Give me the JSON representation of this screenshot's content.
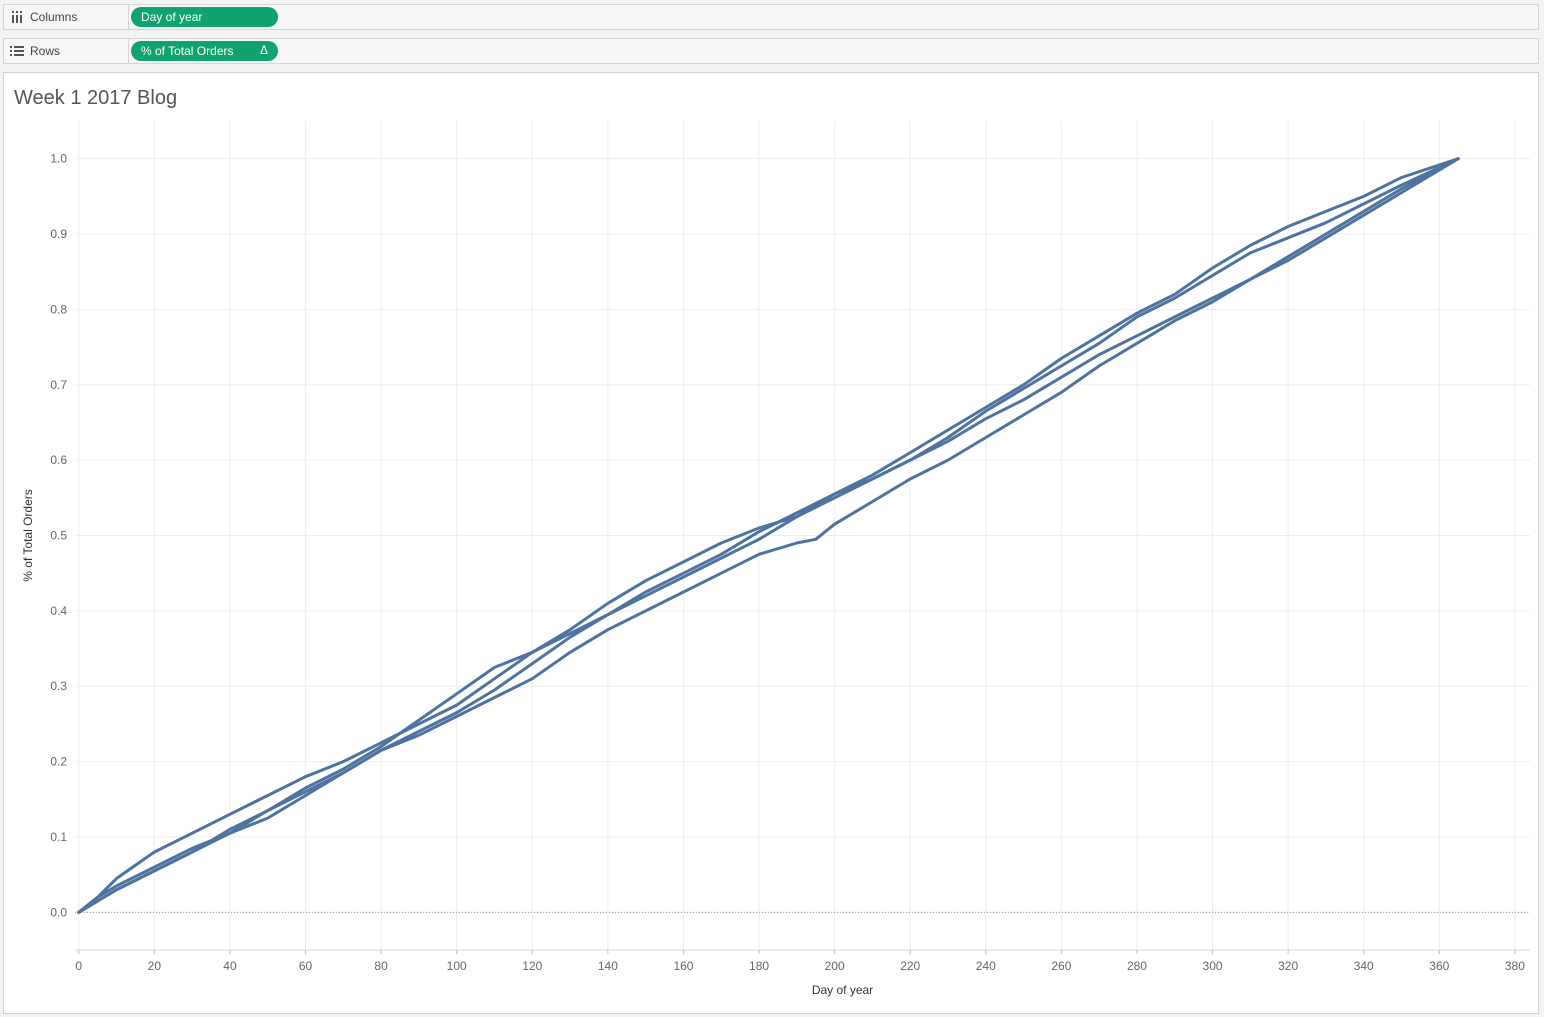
{
  "shelves": {
    "columns": {
      "label": "Columns",
      "icon": "columns-icon",
      "pill": "Day of year"
    },
    "rows": {
      "label": "Rows",
      "icon": "rows-icon",
      "pill": "% of Total Orders",
      "pill_badge": "Δ"
    }
  },
  "colors": {
    "pill": "#10a36d",
    "line": "#4e73a0",
    "grid": "#ededed"
  },
  "view": {
    "title": "Week 1 2017 Blog"
  },
  "chart_data": {
    "type": "line",
    "xlabel": "Day of year",
    "ylabel": "% of Total Orders",
    "xlim": [
      -1,
      384
    ],
    "ylim": [
      -0.05,
      1.05
    ],
    "x_ticks": [
      0,
      20,
      40,
      60,
      80,
      100,
      120,
      140,
      160,
      180,
      200,
      220,
      240,
      260,
      280,
      300,
      320,
      340,
      360,
      380
    ],
    "y_ticks": [
      "0.0",
      "0.1",
      "0.2",
      "0.3",
      "0.4",
      "0.5",
      "0.6",
      "0.7",
      "0.8",
      "0.9",
      "1.0"
    ],
    "grid": true,
    "series": [
      {
        "x": [
          0,
          5,
          10,
          20,
          30,
          40,
          50,
          60,
          70,
          80,
          90,
          100,
          110,
          120,
          130,
          140,
          150,
          160,
          170,
          180,
          190,
          200,
          210,
          220,
          230,
          240,
          250,
          260,
          270,
          280,
          290,
          300,
          310,
          320,
          330,
          340,
          350,
          365
        ],
        "y": [
          0.0,
          0.02,
          0.045,
          0.08,
          0.105,
          0.13,
          0.155,
          0.18,
          0.2,
          0.225,
          0.25,
          0.275,
          0.31,
          0.345,
          0.375,
          0.41,
          0.44,
          0.465,
          0.49,
          0.51,
          0.525,
          0.55,
          0.575,
          0.6,
          0.63,
          0.665,
          0.695,
          0.725,
          0.755,
          0.79,
          0.815,
          0.845,
          0.875,
          0.895,
          0.915,
          0.94,
          0.965,
          1.0
        ]
      },
      {
        "x": [
          0,
          5,
          10,
          20,
          30,
          40,
          50,
          60,
          70,
          80,
          90,
          100,
          110,
          120,
          130,
          140,
          150,
          160,
          170,
          180,
          190,
          200,
          210,
          220,
          230,
          240,
          250,
          260,
          270,
          280,
          290,
          300,
          310,
          320,
          330,
          340,
          350,
          365
        ],
        "y": [
          0.0,
          0.015,
          0.03,
          0.055,
          0.08,
          0.11,
          0.135,
          0.165,
          0.19,
          0.22,
          0.255,
          0.29,
          0.325,
          0.345,
          0.37,
          0.395,
          0.42,
          0.445,
          0.47,
          0.495,
          0.525,
          0.555,
          0.58,
          0.61,
          0.64,
          0.67,
          0.7,
          0.735,
          0.765,
          0.795,
          0.82,
          0.855,
          0.885,
          0.91,
          0.93,
          0.95,
          0.975,
          1.0
        ]
      },
      {
        "x": [
          0,
          5,
          10,
          20,
          30,
          40,
          50,
          60,
          70,
          80,
          90,
          100,
          110,
          120,
          130,
          140,
          150,
          160,
          170,
          180,
          190,
          200,
          210,
          220,
          230,
          240,
          250,
          260,
          270,
          280,
          290,
          300,
          310,
          320,
          330,
          340,
          350,
          365
        ],
        "y": [
          0.0,
          0.02,
          0.035,
          0.06,
          0.085,
          0.105,
          0.135,
          0.16,
          0.185,
          0.215,
          0.24,
          0.265,
          0.295,
          0.33,
          0.365,
          0.395,
          0.425,
          0.45,
          0.475,
          0.505,
          0.53,
          0.555,
          0.575,
          0.6,
          0.625,
          0.655,
          0.68,
          0.71,
          0.74,
          0.765,
          0.79,
          0.815,
          0.84,
          0.87,
          0.9,
          0.93,
          0.96,
          1.0
        ]
      },
      {
        "x": [
          0,
          5,
          10,
          20,
          30,
          40,
          50,
          60,
          70,
          80,
          90,
          100,
          110,
          120,
          130,
          140,
          150,
          160,
          170,
          180,
          190,
          195,
          200,
          210,
          220,
          230,
          240,
          250,
          260,
          270,
          280,
          290,
          300,
          310,
          320,
          330,
          340,
          350,
          365
        ],
        "y": [
          0.0,
          0.015,
          0.03,
          0.055,
          0.08,
          0.105,
          0.125,
          0.155,
          0.185,
          0.215,
          0.235,
          0.26,
          0.285,
          0.31,
          0.345,
          0.375,
          0.4,
          0.425,
          0.45,
          0.475,
          0.49,
          0.495,
          0.515,
          0.545,
          0.575,
          0.6,
          0.63,
          0.66,
          0.69,
          0.725,
          0.755,
          0.785,
          0.81,
          0.84,
          0.865,
          0.895,
          0.925,
          0.955,
          1.0
        ]
      }
    ]
  }
}
